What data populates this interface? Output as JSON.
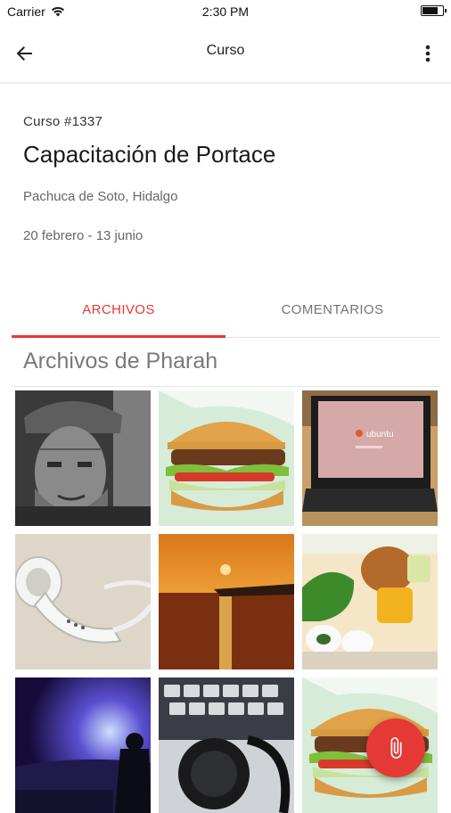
{
  "status_bar": {
    "carrier": "Carrier",
    "time": "2:30 PM",
    "battery_level": 0.8
  },
  "app_bar": {
    "title": "Curso",
    "back_icon": "arrow-back-icon",
    "menu_icon": "more-vert-icon"
  },
  "course": {
    "id_label": "Curso #1337",
    "title": "Capacitación de Portace",
    "location": "Pachuca de Soto, Hidalgo",
    "dates": "20 febrero - 13 junio"
  },
  "tabs": [
    {
      "label": "ARCHIVOS",
      "active": true
    },
    {
      "label": "COMENTARIOS",
      "active": false
    }
  ],
  "files": {
    "section_title": "Archivos de Pharah",
    "items": [
      {
        "subject": "old-man-portrait"
      },
      {
        "subject": "burger"
      },
      {
        "subject": "laptop-ubuntu",
        "screen_text": "ubuntu"
      },
      {
        "subject": "earphones"
      },
      {
        "subject": "sunset-sea"
      },
      {
        "subject": "food-box"
      },
      {
        "subject": "concert-dj"
      },
      {
        "subject": "headphones-keyboard"
      },
      {
        "subject": "burger"
      }
    ]
  },
  "fab": {
    "icon": "attach-icon"
  },
  "colors": {
    "accent": "#e53935",
    "tab_inactive": "#757575",
    "fab": "#e53935"
  }
}
